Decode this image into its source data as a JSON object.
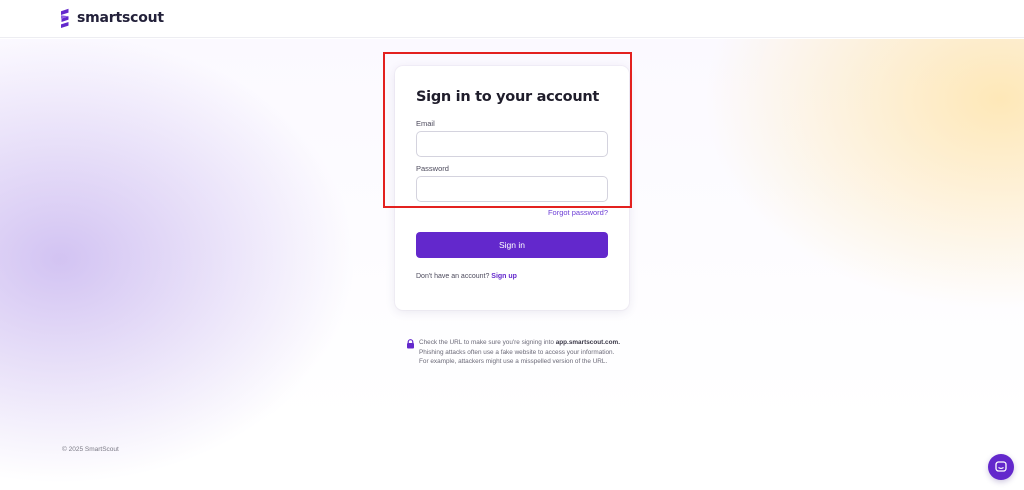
{
  "brand": {
    "name": "smartscout",
    "logo_icon": "smartscout-logo-icon",
    "accent_color": "#6328cc"
  },
  "login": {
    "title": "Sign in to your account",
    "email_label": "Email",
    "email_value": "",
    "password_label": "Password",
    "password_value": "",
    "forgot_password": "Forgot password?",
    "submit_label": "Sign in",
    "signup_prompt": "Don't have an account?",
    "signup_link": "Sign up"
  },
  "security_notice": {
    "icon": "lock-icon",
    "text_before": "Check the URL to make sure you're signing into",
    "domain": "app.smartscout.com.",
    "text_after": "Phishing attacks often use a fake website to access your information. For example, attackers might use a misspelled version of the URL."
  },
  "footer": {
    "copyright": "© 2025 SmartScout"
  },
  "chat": {
    "icon": "chat-bubble-icon"
  },
  "highlight_color": "#e3211f"
}
